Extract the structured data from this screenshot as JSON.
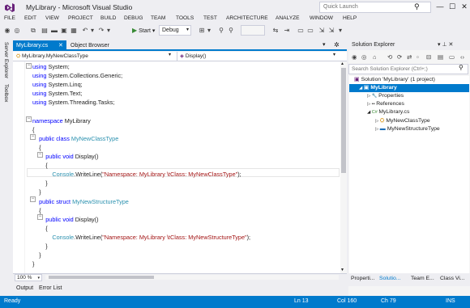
{
  "window": {
    "title": "MyLibrary - Microsoft Visual Studio",
    "quick_launch_placeholder": "Quick Launch",
    "minimize_glyph": "—",
    "maximize_glyph": "☐",
    "close_glyph": "✕"
  },
  "menu": [
    "FILE",
    "EDIT",
    "VIEW",
    "PROJECT",
    "BUILD",
    "DEBUG",
    "TEAM",
    "TOOLS",
    "TEST",
    "ARCHITECTURE",
    "ANALYZE",
    "WINDOW",
    "HELP"
  ],
  "toolbar": {
    "start_label": "Start",
    "configuration": "Debug"
  },
  "left_strip": {
    "server_explorer": "Server Explorer",
    "toolbox": "Toolbox"
  },
  "tabs": {
    "active": "MyLibrary.cs",
    "inactive": "Object Browser"
  },
  "navbar": {
    "type": "MyLibrary.MyNewClassType",
    "member": "Display()"
  },
  "code": [
    [
      {
        "t": "using",
        "c": "kw"
      },
      {
        "t": " System;"
      }
    ],
    [
      {
        "t": "using",
        "c": "kw"
      },
      {
        "t": " System.Collections.Generic;"
      }
    ],
    [
      {
        "t": "using",
        "c": "kw"
      },
      {
        "t": " System.Linq;"
      }
    ],
    [
      {
        "t": "using",
        "c": "kw"
      },
      {
        "t": " System.Text;"
      }
    ],
    [
      {
        "t": "using",
        "c": "kw"
      },
      {
        "t": " System.Threading.Tasks;"
      }
    ],
    [],
    [
      {
        "t": "namespace",
        "c": "kw"
      },
      {
        "t": " MyLibrary"
      }
    ],
    [
      {
        "t": "{"
      }
    ],
    [
      {
        "t": "    "
      },
      {
        "t": "public",
        "c": "kw"
      },
      {
        "t": " "
      },
      {
        "t": "class",
        "c": "kw"
      },
      {
        "t": " "
      },
      {
        "t": "MyNewClassType",
        "c": "ty"
      }
    ],
    [
      {
        "t": "    {"
      }
    ],
    [
      {
        "t": "        "
      },
      {
        "t": "public",
        "c": "kw"
      },
      {
        "t": " "
      },
      {
        "t": "void",
        "c": "kw"
      },
      {
        "t": " Display()"
      }
    ],
    [
      {
        "t": "        {"
      }
    ],
    [
      {
        "t": "            "
      },
      {
        "t": "Console",
        "c": "ty"
      },
      {
        "t": ".WriteLine("
      },
      {
        "t": "\"Namespace: MyLibrary \\tClass: MyNewClassType\"",
        "c": "str"
      },
      {
        "t": ");"
      }
    ],
    [
      {
        "t": "        }"
      }
    ],
    [
      {
        "t": "    }"
      }
    ],
    [
      {
        "t": "    "
      },
      {
        "t": "public",
        "c": "kw"
      },
      {
        "t": " "
      },
      {
        "t": "struct",
        "c": "kw"
      },
      {
        "t": " "
      },
      {
        "t": "MyNewStructureType",
        "c": "ty"
      }
    ],
    [
      {
        "t": "    {"
      }
    ],
    [
      {
        "t": "        "
      },
      {
        "t": "public",
        "c": "kw"
      },
      {
        "t": " "
      },
      {
        "t": "void",
        "c": "kw"
      },
      {
        "t": " Display()"
      }
    ],
    [
      {
        "t": "        {"
      }
    ],
    [
      {
        "t": "            "
      },
      {
        "t": "Console",
        "c": "ty"
      },
      {
        "t": ".WriteLine("
      },
      {
        "t": "\"Namespace: MyLibrary \\tClass: MyNewStructureType\"",
        "c": "str"
      },
      {
        "t": ");"
      }
    ],
    [
      {
        "t": "        }"
      }
    ],
    [
      {
        "t": "    }"
      }
    ],
    [
      {
        "t": "}"
      }
    ]
  ],
  "editor": {
    "zoom": "100 %"
  },
  "bottom_tabs": [
    "Output",
    "Error List"
  ],
  "solution_explorer": {
    "title": "Solution Explorer",
    "search_placeholder": "Search Solution Explorer (Ctrl+;)",
    "tree": [
      {
        "label": "Solution 'MyLibrary' (1 project)",
        "icon": "solution-icon",
        "arrow": ""
      },
      {
        "label": "MyLibrary",
        "icon": "csharp-project-icon",
        "arrow": "◢",
        "bold": true
      },
      {
        "label": "Properties",
        "icon": "wrench-icon",
        "arrow": "▷"
      },
      {
        "label": "References",
        "icon": "references-icon",
        "arrow": "▷"
      },
      {
        "label": "MyLibrary.cs",
        "icon": "csharp-file-icon",
        "arrow": "◢"
      },
      {
        "label": "MyNewClassType",
        "icon": "class-icon",
        "arrow": "▷"
      },
      {
        "label": "MyNewStructureType",
        "icon": "struct-icon",
        "arrow": "▷"
      }
    ],
    "tabs": [
      "Properti...",
      "Solutio...",
      "Team E...",
      "Class Vi..."
    ]
  },
  "status": {
    "state": "Ready",
    "line": "Ln 13",
    "col": "Col 160",
    "ch": "Ch 79",
    "mode": "INS"
  },
  "colors": {
    "accent": "#007acc",
    "keyword": "#0000ff",
    "type": "#2b91af",
    "string": "#a31515"
  }
}
